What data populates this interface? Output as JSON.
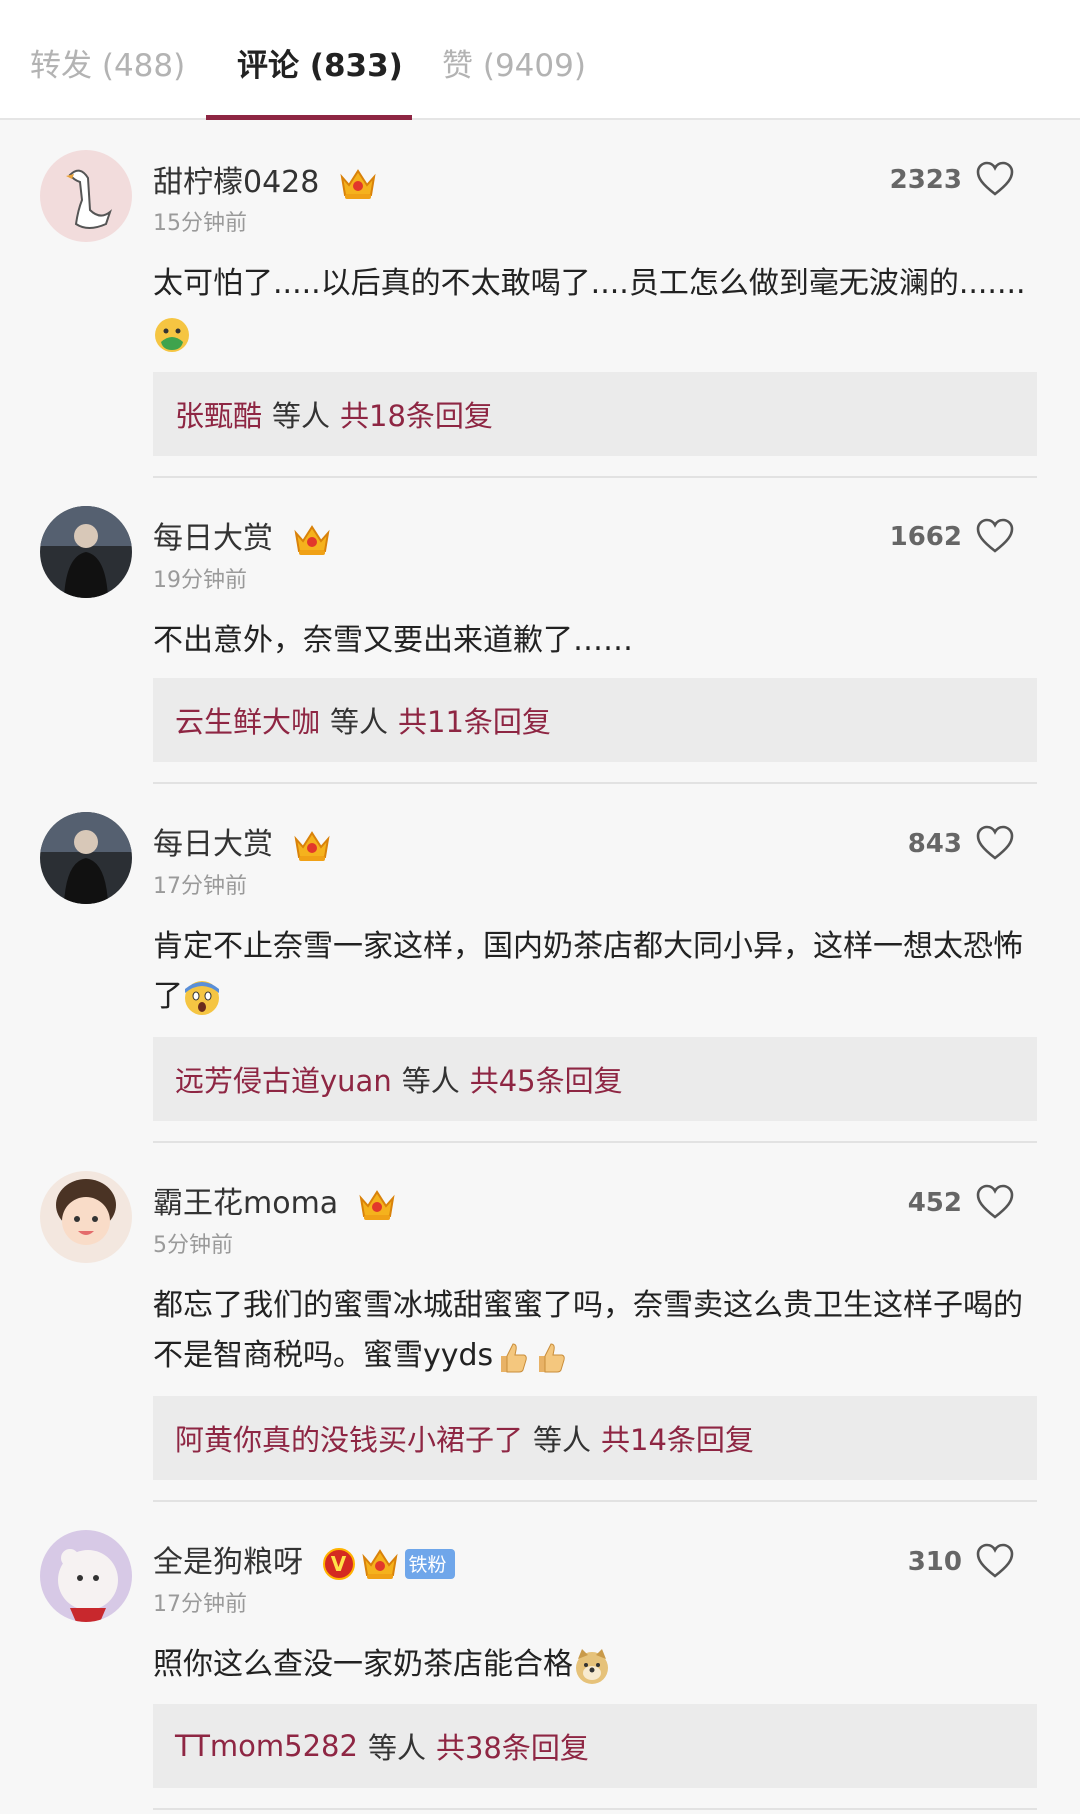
{
  "tabs": [
    {
      "label": "转发 (488)"
    },
    {
      "label": "评论 (833)"
    },
    {
      "label": "赞 (9409)"
    }
  ],
  "comments": [
    {
      "username": "甜柠檬0428",
      "time": "15分钟前",
      "likes": "2323",
      "text": "太可怕了.....以后真的不太敢喝了....员工怎么做到毫无波澜的.......",
      "emoji": "nauseated-face",
      "reply_user": "张甄酷",
      "reply_mid": "等人",
      "reply_count": "共18条回复"
    },
    {
      "username": "每日大赏",
      "time": "19分钟前",
      "likes": "1662",
      "text": "不出意外，奈雪又要出来道歉了……",
      "reply_user": "云生鲜大咖",
      "reply_mid": "等人",
      "reply_count": "共11条回复"
    },
    {
      "username": "每日大赏",
      "time": "17分钟前",
      "likes": "843",
      "text": "肯定不止奈雪一家这样，国内奶茶店都大同小异，这样一想太恐怖了",
      "emoji": "screaming-face",
      "reply_user": "远芳侵古道yuan",
      "reply_mid": "等人",
      "reply_count": "共45条回复"
    },
    {
      "username": "霸王花moma",
      "time": "5分钟前",
      "likes": "452",
      "text": "都忘了我们的蜜雪冰城甜蜜蜜了吗，奈雪卖这么贵卫生这样子喝的不是智商税吗。蜜雪yyds",
      "emoji": "thumbs-up x2",
      "reply_user": "阿黄你真的没钱买小裙子了",
      "reply_mid": "等人",
      "reply_count": "共14条回复"
    },
    {
      "username": "全是狗粮呀",
      "time": "17分钟前",
      "likes": "310",
      "text": "照你这么查没一家奶茶店能合格",
      "emoji": "doge",
      "badge_v": "V",
      "badge_fan": "铁粉",
      "reply_user": "TTmom5282",
      "reply_mid": "等人",
      "reply_count": "共38条回复"
    }
  ]
}
